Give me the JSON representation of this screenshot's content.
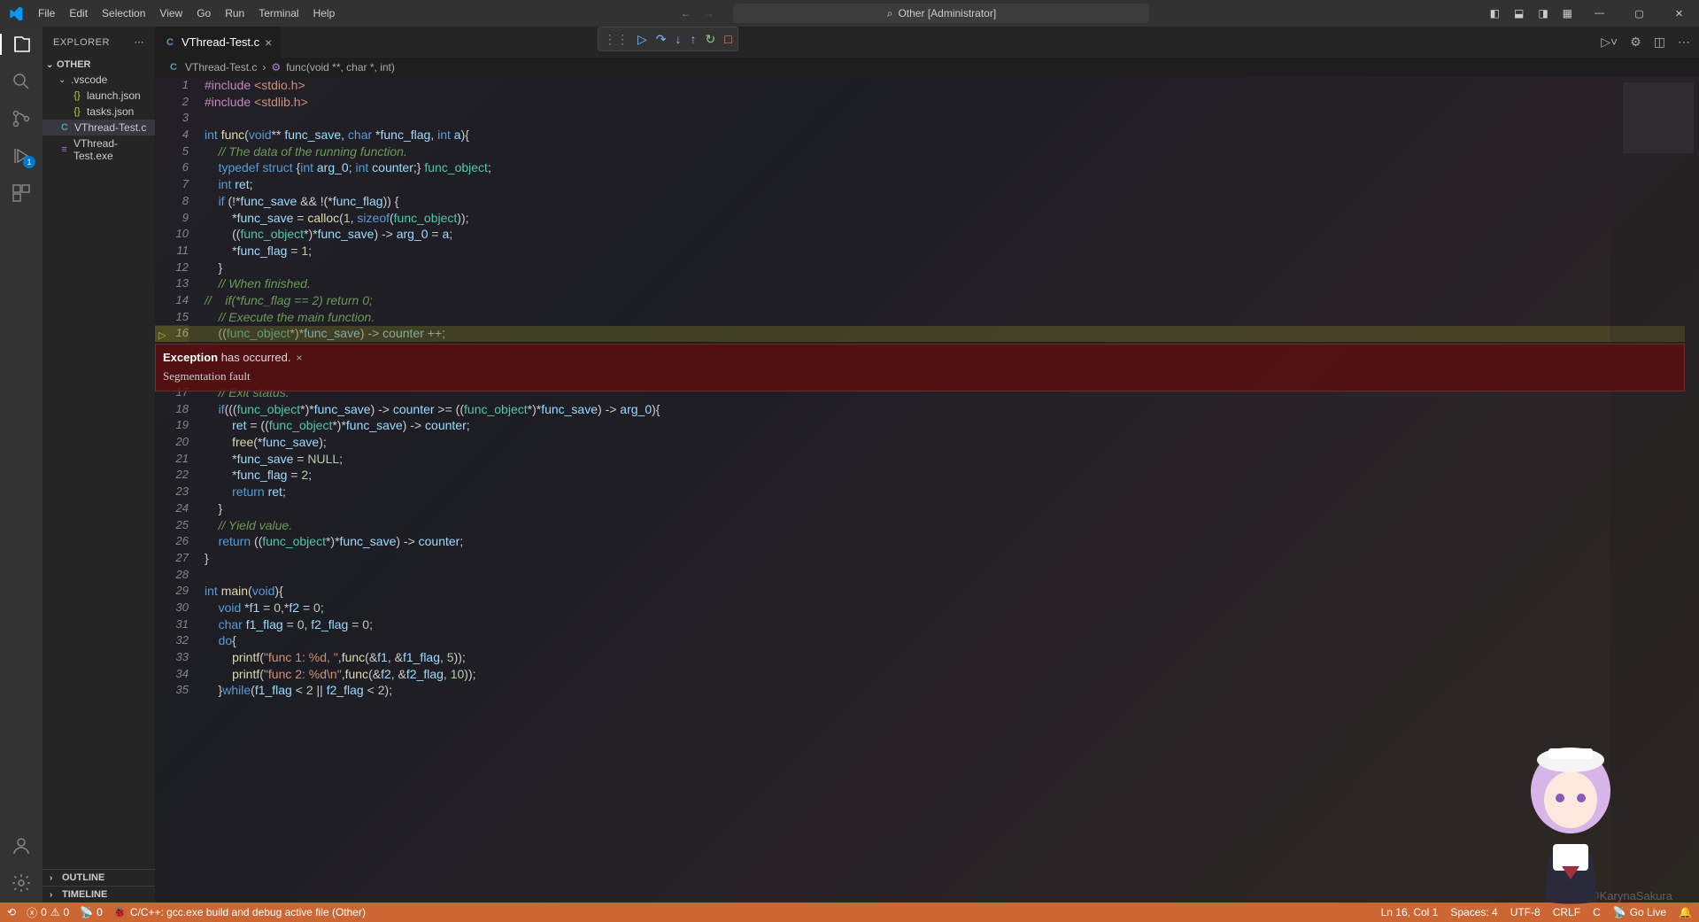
{
  "titlebar": {
    "menus": [
      "File",
      "Edit",
      "Selection",
      "View",
      "Go",
      "Run",
      "Terminal",
      "Help"
    ],
    "search_label": "Other [Administrator]"
  },
  "activitybar": {
    "badge": "1"
  },
  "sidebar": {
    "title": "EXPLORER",
    "root": "OTHER",
    "folder": ".vscode",
    "items": [
      {
        "icon": "json",
        "label": "launch.json"
      },
      {
        "icon": "json",
        "label": "tasks.json"
      }
    ],
    "files": [
      {
        "icon": "c",
        "label": "VThread-Test.c",
        "selected": true
      },
      {
        "icon": "exe",
        "label": "VThread-Test.exe"
      }
    ],
    "outline": "OUTLINE",
    "timeline": "TIMELINE"
  },
  "tabs": {
    "active": "VThread-Test.c"
  },
  "breadcrumb": {
    "file": "VThread-Test.c",
    "symbol": "func(void **, char *, int)"
  },
  "exception": {
    "title_bold": "Exception",
    "title_rest": " has occurred.",
    "detail": "Segmentation fault"
  },
  "code": {
    "lines": [
      {
        "n": 1,
        "html": "<span class='tk-inc'>#include</span> <span class='tk-str'>&lt;stdio.h&gt;</span>"
      },
      {
        "n": 2,
        "html": "<span class='tk-inc'>#include</span> <span class='tk-str'>&lt;stdlib.h&gt;</span>"
      },
      {
        "n": 3,
        "html": ""
      },
      {
        "n": 4,
        "html": "<span class='tk-type'>int</span> <span class='tk-fn'>func</span>(<span class='tk-type'>void</span>** <span class='tk-var'>func_save</span>, <span class='tk-type'>char</span> *<span class='tk-var'>func_flag</span>, <span class='tk-type'>int</span> <span class='tk-var'>a</span>){"
      },
      {
        "n": 5,
        "html": "    <span class='tk-com'>// The data of the running function.</span>"
      },
      {
        "n": 6,
        "html": "    <span class='tk-kw'>typedef</span> <span class='tk-kw'>struct</span> {<span class='tk-type'>int</span> <span class='tk-var'>arg_0</span>; <span class='tk-type'>int</span> <span class='tk-var'>counter</span>;} <span class='tk-ptr'>func_object</span>;"
      },
      {
        "n": 7,
        "html": "    <span class='tk-type'>int</span> <span class='tk-var'>ret</span>;"
      },
      {
        "n": 8,
        "html": "    <span class='tk-kw'>if</span> (!*<span class='tk-var'>func_save</span> && !(*<span class='tk-var'>func_flag</span>)) {"
      },
      {
        "n": 9,
        "html": "        *<span class='tk-var'>func_save</span> = <span class='tk-fn'>calloc</span>(<span class='tk-num'>1</span>, <span class='tk-kw'>sizeof</span>(<span class='tk-ptr'>func_object</span>));"
      },
      {
        "n": 10,
        "html": "        ((<span class='tk-ptr'>func_object</span>*)*<span class='tk-var'>func_save</span>) -> <span class='tk-var'>arg_0</span> = <span class='tk-var'>a</span>;"
      },
      {
        "n": 11,
        "html": "        *<span class='tk-var'>func_flag</span> = <span class='tk-num'>1</span>;"
      },
      {
        "n": 12,
        "html": "    }"
      },
      {
        "n": 13,
        "html": "    <span class='tk-com'>// When finished.</span>"
      },
      {
        "n": 14,
        "html": "<span class='tk-com'>//    if(*func_flag == 2) return 0;</span>"
      },
      {
        "n": 15,
        "html": "    <span class='tk-com'>// Execute the main function.</span>"
      },
      {
        "n": 16,
        "html": "    ((<span class='tk-ptr'>func_object</span>*)*<span class='tk-var'>func_save</span>) -> <span class='tk-var'>counter</span> ++;",
        "hl": true,
        "bp": true
      },
      {
        "n": 17,
        "html": "    <span class='tk-com'>// Exit status.</span>"
      },
      {
        "n": 18,
        "html": "    <span class='tk-kw'>if</span>(((<span class='tk-ptr'>func_object</span>*)*<span class='tk-var'>func_save</span>) -> <span class='tk-var'>counter</span> >= ((<span class='tk-ptr'>func_object</span>*)*<span class='tk-var'>func_save</span>) -> <span class='tk-var'>arg_0</span>){"
      },
      {
        "n": 19,
        "html": "        <span class='tk-var'>ret</span> = ((<span class='tk-ptr'>func_object</span>*)*<span class='tk-var'>func_save</span>) -> <span class='tk-var'>counter</span>;"
      },
      {
        "n": 20,
        "html": "        <span class='tk-fn'>free</span>(*<span class='tk-var'>func_save</span>);"
      },
      {
        "n": 21,
        "html": "        *<span class='tk-var'>func_save</span> = <span class='tk-num'>NULL</span>;"
      },
      {
        "n": 22,
        "html": "        *<span class='tk-var'>func_flag</span> = <span class='tk-num'>2</span>;"
      },
      {
        "n": 23,
        "html": "        <span class='tk-kw'>return</span> <span class='tk-var'>ret</span>;"
      },
      {
        "n": 24,
        "html": "    }"
      },
      {
        "n": 25,
        "html": "    <span class='tk-com'>// Yield value.</span>"
      },
      {
        "n": 26,
        "html": "    <span class='tk-kw'>return</span> ((<span class='tk-ptr'>func_object</span>*)*<span class='tk-var'>func_save</span>) -> <span class='tk-var'>counter</span>;"
      },
      {
        "n": 27,
        "html": "}"
      },
      {
        "n": 28,
        "html": ""
      },
      {
        "n": 29,
        "html": "<span class='tk-type'>int</span> <span class='tk-fn'>main</span>(<span class='tk-type'>void</span>){"
      },
      {
        "n": 30,
        "html": "    <span class='tk-type'>void</span> *<span class='tk-var'>f1</span> = <span class='tk-num'>0</span>,*<span class='tk-var'>f2</span> = <span class='tk-num'>0</span>;"
      },
      {
        "n": 31,
        "html": "    <span class='tk-type'>char</span> <span class='tk-var'>f1_flag</span> = <span class='tk-num'>0</span>, <span class='tk-var'>f2_flag</span> = <span class='tk-num'>0</span>;"
      },
      {
        "n": 32,
        "html": "    <span class='tk-kw'>do</span>{"
      },
      {
        "n": 33,
        "html": "        <span class='tk-fn'>printf</span>(<span class='tk-str'>\"func 1: %d, \"</span>,<span class='tk-fn'>func</span>(&<span class='tk-var'>f1</span>, &<span class='tk-var'>f1_flag</span>, <span class='tk-num'>5</span>));"
      },
      {
        "n": 34,
        "html": "        <span class='tk-fn'>printf</span>(<span class='tk-str'>\"func 2: %d\\n\"</span>,<span class='tk-fn'>func</span>(&<span class='tk-var'>f2</span>, &<span class='tk-var'>f2_flag</span>, <span class='tk-num'>10</span>));"
      },
      {
        "n": 35,
        "html": "    }<span class='tk-kw'>while</span>(<span class='tk-var'>f1_flag</span> &lt; <span class='tk-num'>2</span> || <span class='tk-var'>f2_flag</span> &lt; <span class='tk-num'>2</span>);"
      }
    ]
  },
  "statusbar": {
    "errors": "0",
    "warnings": "0",
    "ports": "0",
    "task": "C/C++: gcc.exe build and debug active file (Other)",
    "ln": "Ln 16, Col 1",
    "spaces": "Spaces: 4",
    "enc": "UTF-8",
    "eol": "CRLF",
    "lang": "C",
    "live": "Go Live"
  },
  "watermark": "CSDN @KarynaSakura"
}
